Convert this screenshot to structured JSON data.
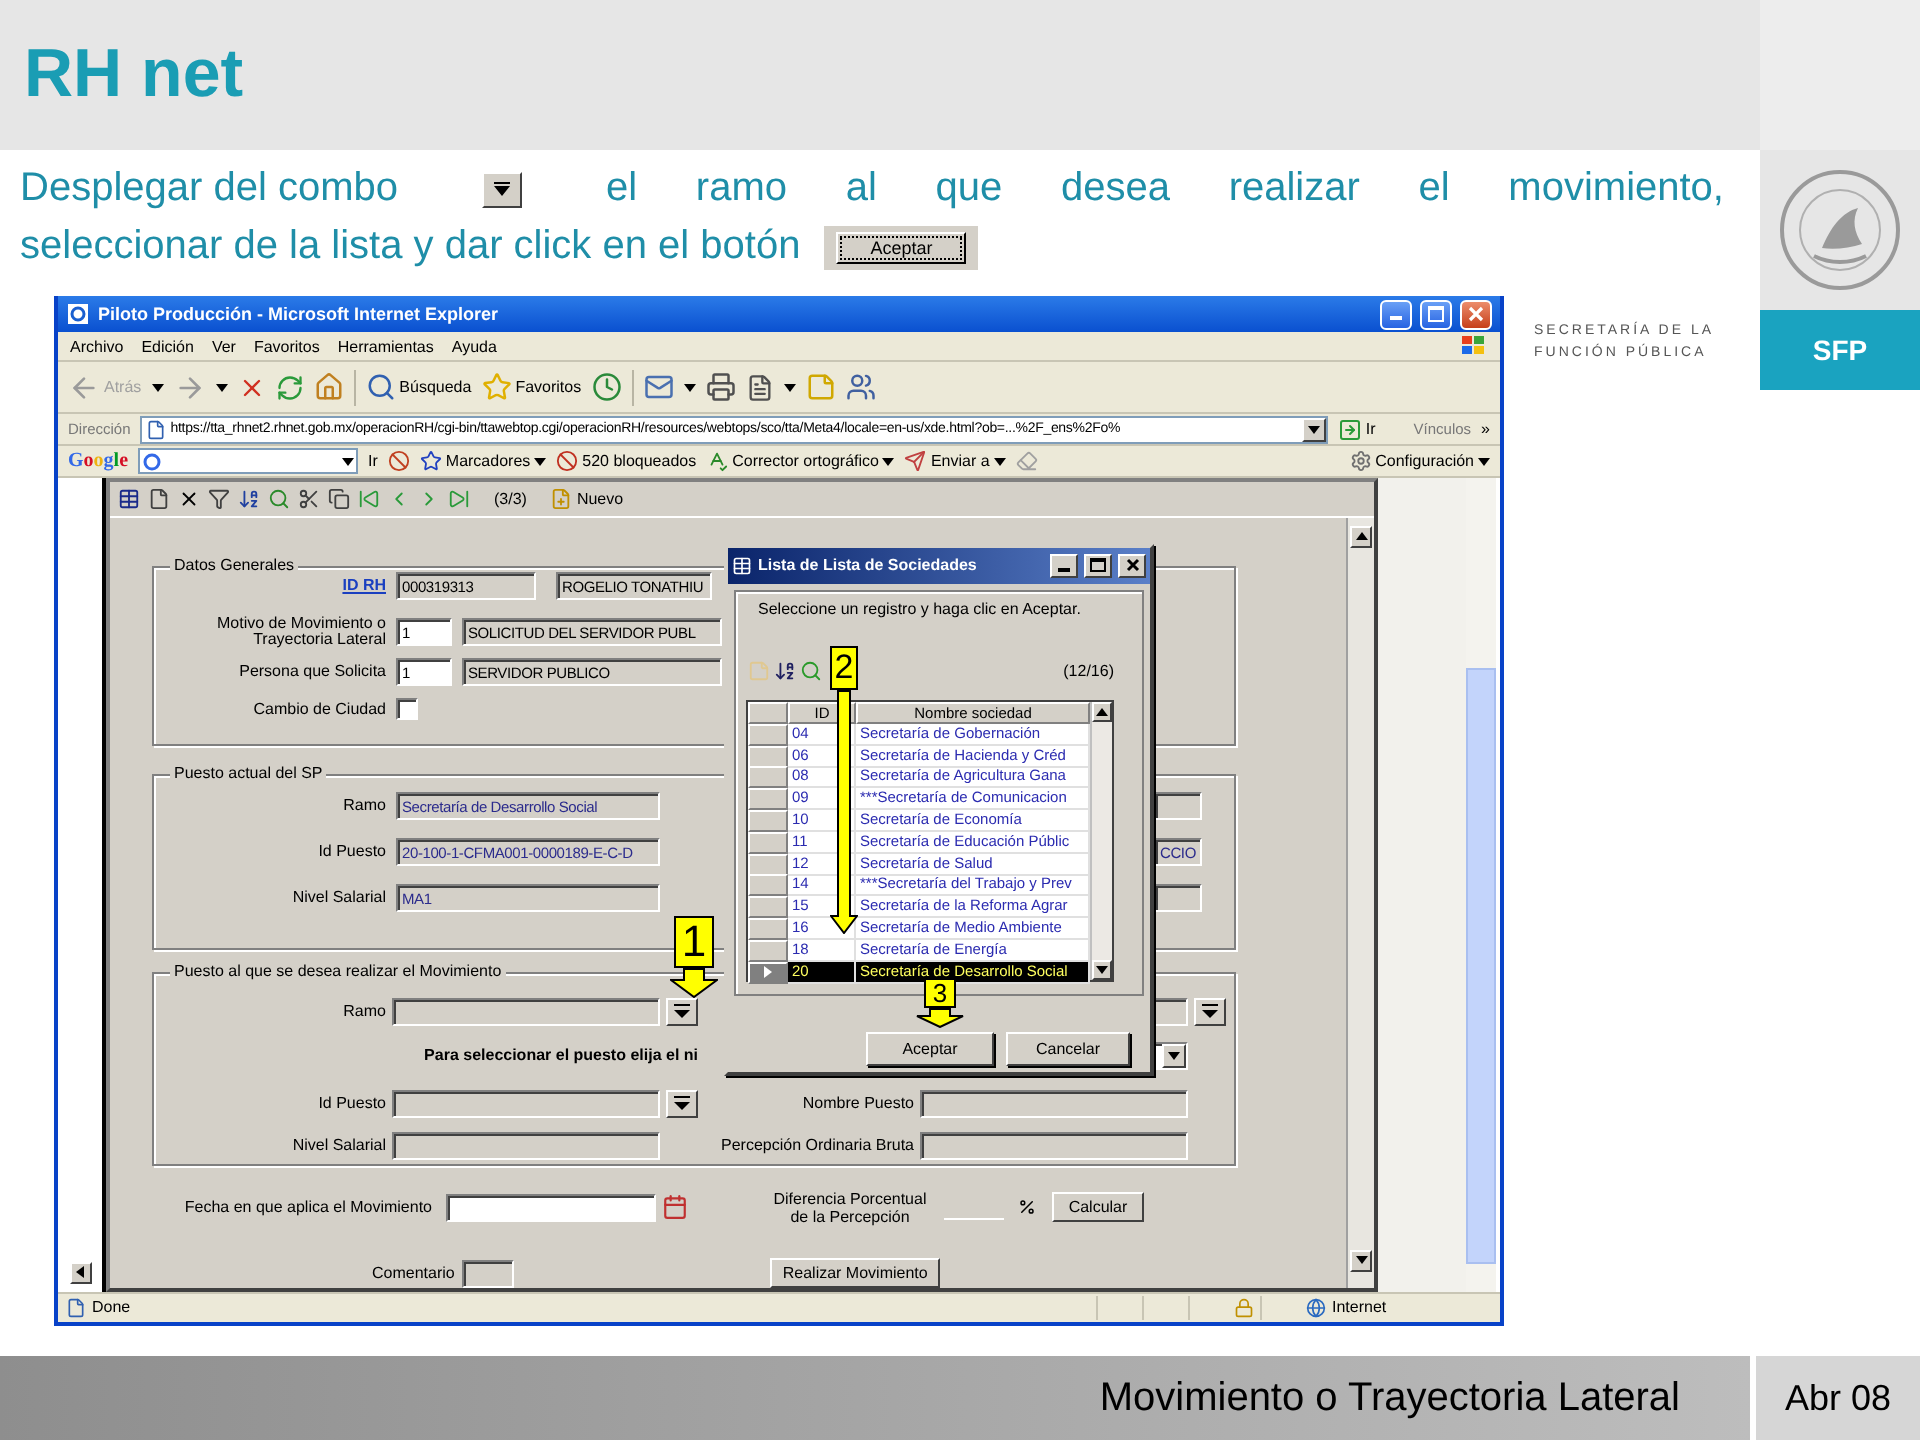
{
  "slide": {
    "title": "RH net",
    "instruction": {
      "line1_start": "Desplegar del combo",
      "line1_end": "el ramo al que desea realizar el movimiento,",
      "line2": "seleccionar de la lista y dar click en el botón",
      "button": "Aceptar"
    },
    "org_name": [
      "SECRETARÍA DE LA",
      "FUNCIÓN PÚBLICA"
    ],
    "org_badge": "SFP",
    "footer": {
      "title": "Movimiento o Trayectoria Lateral",
      "date": "Abr 08"
    }
  },
  "browser": {
    "title": "Piloto Producción - Microsoft Internet Explorer",
    "menu": [
      "Archivo",
      "Edición",
      "Ver",
      "Favoritos",
      "Herramientas",
      "Ayuda"
    ],
    "toolbar": {
      "back": {
        "label": "Atrás",
        "disabled": true
      },
      "search": "Búsqueda",
      "favorites": "Favoritos"
    },
    "address": {
      "label": "Dirección",
      "url": "https://tta_rhnet2.rhnet.gob.mx/operacionRH/cgi-bin/ttawebtop.cgi/operacionRH/resources/webtops/sco/tta/Meta4/locale=en-us/xde.html?ob=...%2F_ens%2Fo%",
      "go": "Ir",
      "links": "Vínculos",
      "more": "»"
    },
    "google": {
      "logo": "Google",
      "go": "Ir",
      "bookmarks": "Marcadores",
      "blocked": "520 bloqueados",
      "spell": "Corrector ortográfico",
      "send": "Enviar a",
      "settings": "Configuración"
    },
    "status": {
      "text": "Done",
      "zone": "Internet"
    }
  },
  "app": {
    "counter": "(3/3)",
    "new": "Nuevo"
  },
  "form": {
    "datos": {
      "legend": "Datos Generales",
      "rows": [
        {
          "kind": "link",
          "label": [
            "ID RH"
          ],
          "fields": [
            {
              "value": "000319313",
              "editable": false
            },
            {
              "value": "ROGELIO TONATHIU",
              "editable": false
            }
          ]
        },
        {
          "kind": "text",
          "label": [
            "Motivo  de Movimiento o",
            "Trayectoria Lateral"
          ],
          "fields": [
            {
              "value": "1",
              "editable": true
            },
            {
              "value": "SOLICITUD DEL SERVIDOR PUBL",
              "editable": false
            }
          ]
        },
        {
          "kind": "text",
          "label": [
            "Persona que Solicita"
          ],
          "fields": [
            {
              "value": "1",
              "editable": true
            },
            {
              "value": "SERVIDOR PUBLICO",
              "editable": false
            }
          ]
        },
        {
          "kind": "checkbox",
          "label": [
            "Cambio de Ciudad"
          ],
          "checked": false
        }
      ]
    },
    "actual": {
      "legend": "Puesto actual del SP",
      "rows": [
        {
          "label": "Ramo",
          "value": "Secretaría de Desarrollo Social"
        },
        {
          "label": "Id Puesto",
          "value": "20-100-1-CFMA001-0000189-E-C-D",
          "side": "CCIO"
        },
        {
          "label": "Nivel Salarial",
          "value": "MA1"
        }
      ]
    },
    "destino": {
      "legend": "Puesto al que se desea realizar el Movimiento",
      "ramo_label": "Ramo",
      "hint": "Para seleccionar el puesto elija el ni",
      "id_label": "Id Puesto",
      "nombre_label": "Nombre Puesto",
      "nivel_label": "Nivel Salarial",
      "percepcion_label": "Percepción Ordinaria Bruta"
    },
    "fecha_label": "Fecha en que aplica el Movimiento",
    "diferencia_label": [
      "Diferencia Porcentual",
      "de la Percepción"
    ],
    "calcular": "Calcular",
    "comentario_label": "Comentario",
    "realizar": "Realizar Movimiento"
  },
  "dialog": {
    "title": "Lista de Lista de Sociedades",
    "message": "Seleccione un registro y haga clic en Aceptar.",
    "counter": "(12/16)",
    "columns": [
      "ID",
      "Nombre sociedad"
    ],
    "rows": [
      {
        "id": "04",
        "name": "Secretaría de Gobernación",
        "selected": false
      },
      {
        "id": "06",
        "name": "Secretaría de Hacienda y Créd",
        "selected": false
      },
      {
        "id": "08",
        "name": "Secretaría de Agricultura Gana",
        "selected": false
      },
      {
        "id": "09",
        "name": "***Secretaría de Comunicacion",
        "selected": false
      },
      {
        "id": "10",
        "name": "Secretaría de Economía",
        "selected": false
      },
      {
        "id": "11",
        "name": "Secretaría de Educación Públic",
        "selected": false
      },
      {
        "id": "12",
        "name": "Secretaría de Salud",
        "selected": false
      },
      {
        "id": "14",
        "name": "***Secretaría del Trabajo y Prev",
        "selected": false
      },
      {
        "id": "15",
        "name": "Secretaría de la Reforma Agrar",
        "selected": false
      },
      {
        "id": "16",
        "name": "Secretaría de Medio Ambiente",
        "selected": false
      },
      {
        "id": "18",
        "name": "Secretaría de Energía",
        "selected": false
      },
      {
        "id": "20",
        "name": "Secretaría de Desarrollo Social",
        "selected": true
      }
    ],
    "buttons": [
      "Aceptar",
      "Cancelar"
    ]
  },
  "callouts": [
    "1",
    "2",
    "3"
  ]
}
